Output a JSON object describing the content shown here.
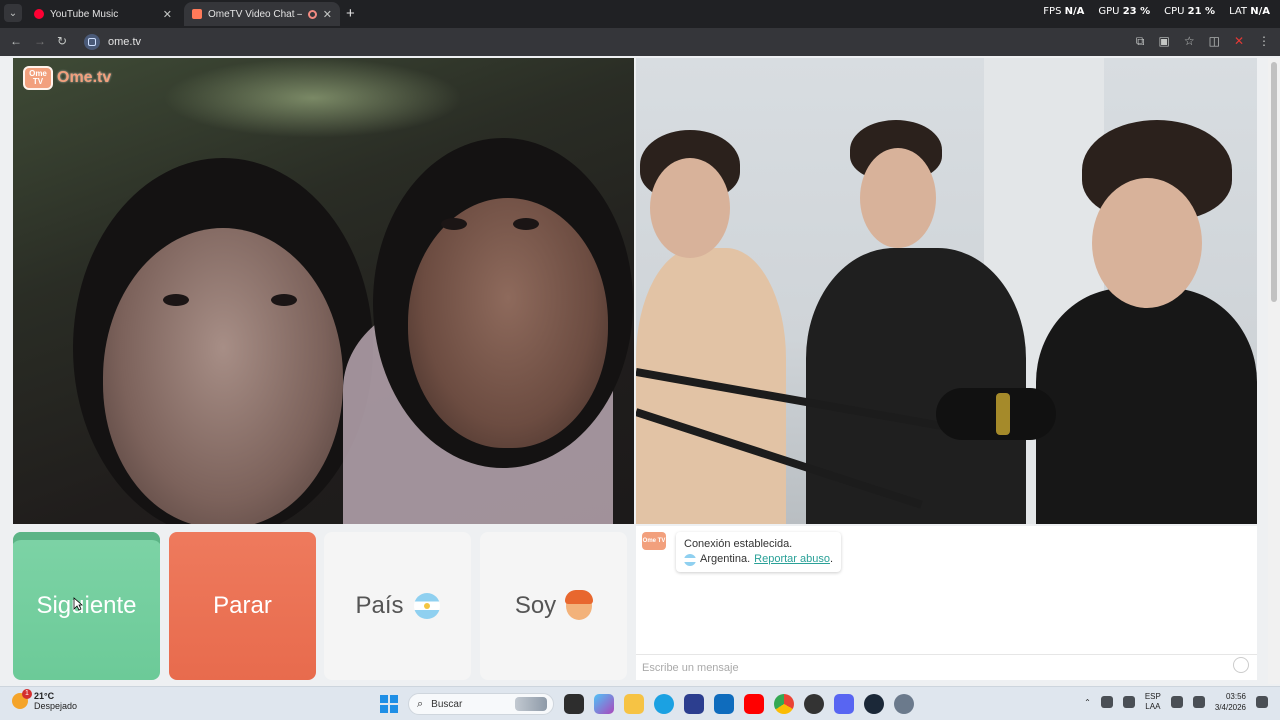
{
  "browser": {
    "tabs": [
      {
        "title": "YouTube Music",
        "icon": "youtube-music-icon"
      },
      {
        "title": "OmeTV Video Chat — Ome",
        "icon": "ometv-icon",
        "active": true
      }
    ],
    "url": "ome.tv",
    "overlay": {
      "fps_label": "FPS",
      "fps_value": "N/A",
      "gpu_label": "GPU",
      "gpu_value": "23 %",
      "cpu_label": "CPU",
      "cpu_value": "21 %",
      "lat_label": "LAT",
      "lat_value": "N/A"
    }
  },
  "page": {
    "logo_text": "Ome.tv",
    "logo_badge": "Ome TV",
    "buttons": {
      "next": "Siguiente",
      "stop": "Parar",
      "country": "País",
      "soy": "Soy"
    },
    "chat": {
      "status": "Conexión establecida.",
      "country": "Argentina.",
      "report_link": "Reportar abuso",
      "report_suffix": ".",
      "input_placeholder": "Escribe un mensaje"
    }
  },
  "taskbar": {
    "weather_temp": "21°C",
    "weather_desc": "Despejado",
    "search_placeholder": "Buscar",
    "lang_top": "ESP",
    "lang_bottom": "LAA",
    "time": "03:56",
    "date": "3/4/2026"
  },
  "colors": {
    "next_button": "#6cca98",
    "stop_button": "#e86b4d",
    "brand": "#f2a07d"
  }
}
